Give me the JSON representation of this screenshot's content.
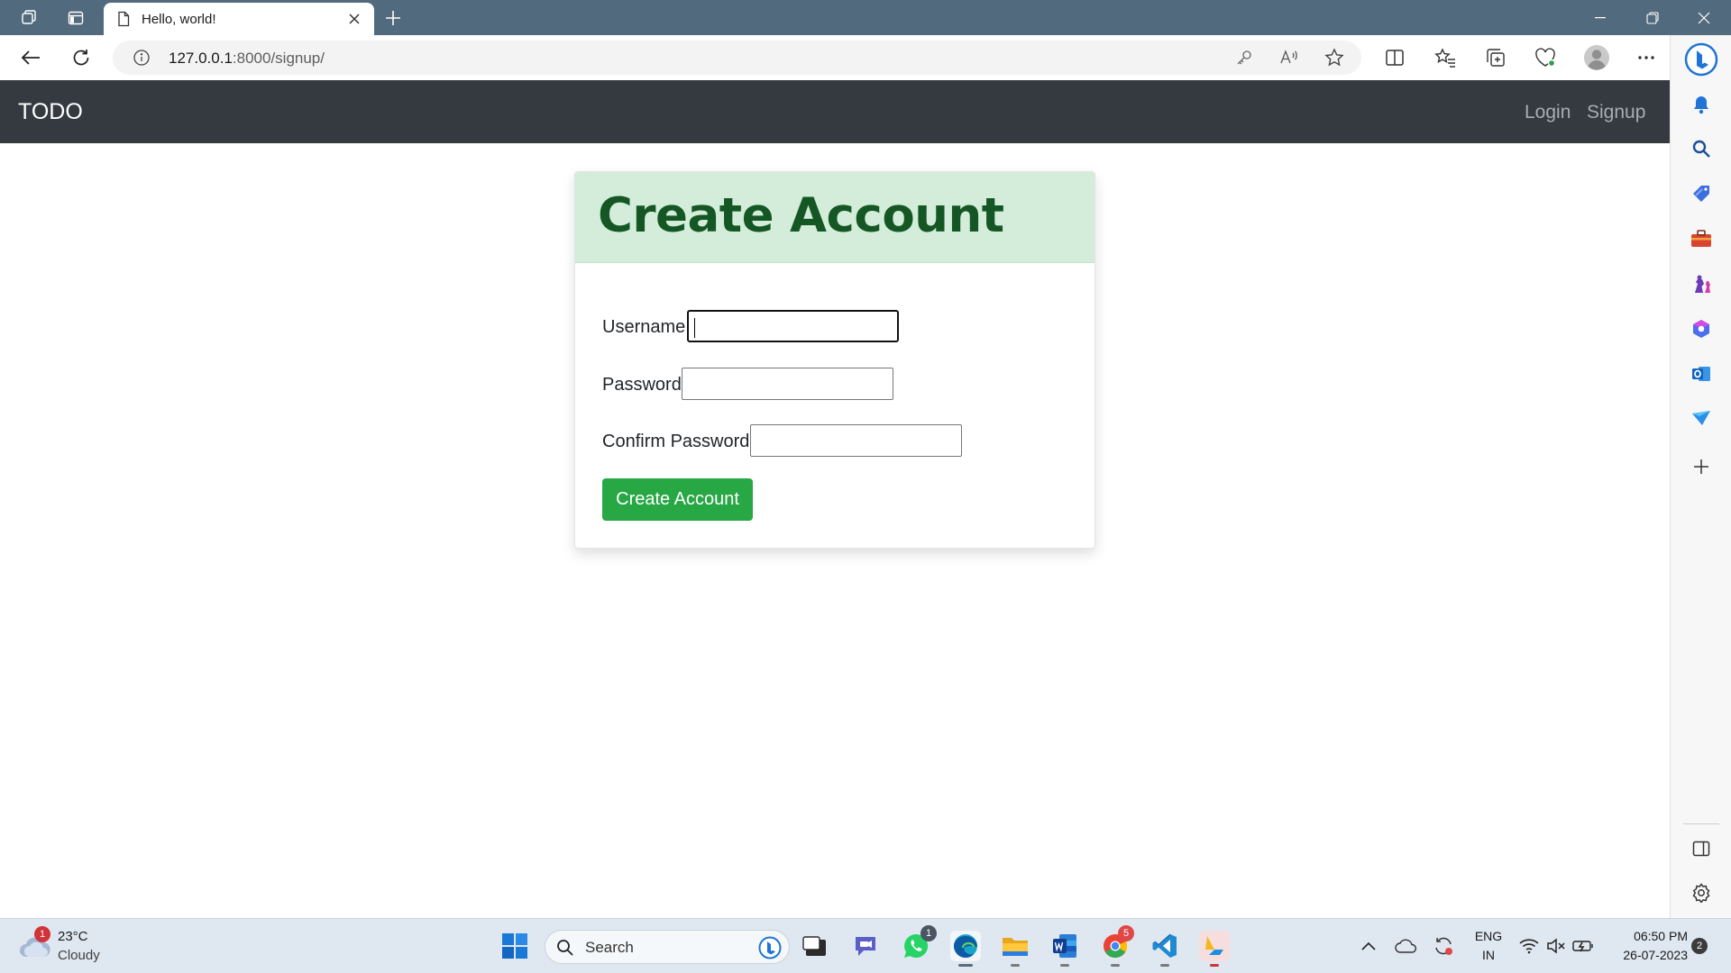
{
  "browser": {
    "tab_title": "Hello, world!",
    "url_host": "127.0.0.1",
    "url_path": ":8000/signup/"
  },
  "navbar": {
    "brand": "TODO",
    "links": [
      "Login",
      "Signup"
    ]
  },
  "form": {
    "title": "Create Account",
    "username_label": "Username",
    "password_label": "Password",
    "confirm_label": "Confirm Password",
    "submit_label": "Create Account",
    "username_value": "",
    "password_value": "",
    "confirm_value": ""
  },
  "taskbar": {
    "weather_temp": "23°C",
    "weather_desc": "Cloudy",
    "weather_badge": "1",
    "search_label": "Search",
    "whatsapp_badge": "1",
    "chrome_badge": "5",
    "lang_top": "ENG",
    "lang_bottom": "IN",
    "time": "06:50 PM",
    "date": "26-07-2023",
    "notification_count": "2"
  },
  "colors": {
    "navbar_bg": "#343a40",
    "header_bg": "#d4edda",
    "header_text": "#155724",
    "button_bg": "#28a745"
  }
}
